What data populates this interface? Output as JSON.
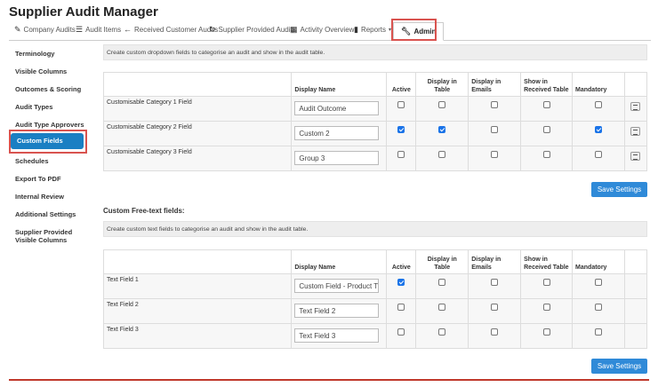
{
  "app": {
    "title": "Supplier Audit Manager"
  },
  "nav": {
    "items": [
      {
        "icon": "edit-icon",
        "label": "Company Audits"
      },
      {
        "icon": "list-icon",
        "label": "Audit Items"
      },
      {
        "icon": "arrow-left-icon",
        "label": "Received Customer Audits"
      },
      {
        "icon": "refresh-icon",
        "label": "Supplier Provided Audits"
      },
      {
        "icon": "table-icon",
        "label": "Activity Overview"
      },
      {
        "icon": "file-icon",
        "label": "Reports"
      },
      {
        "icon": "wrench-icon",
        "label": "Admin"
      }
    ]
  },
  "sidebar": {
    "items": [
      {
        "label": "Terminology"
      },
      {
        "label": "Visible Columns"
      },
      {
        "label": "Outcomes & Scoring"
      },
      {
        "label": "Audit Types"
      },
      {
        "label": "Audit Type Approvers"
      },
      {
        "label": "Custom Fields",
        "active": true
      },
      {
        "label": "Schedules"
      },
      {
        "label": "Export To PDF"
      },
      {
        "label": "Internal Review"
      },
      {
        "label": "Additional Settings"
      },
      {
        "label": "Supplier Provided Visible Columns"
      }
    ]
  },
  "dropdown_section": {
    "description": "Create custom dropdown fields to categorise an audit and show in the audit table.",
    "headers": [
      "",
      "Display Name",
      "Active",
      "Display in Table",
      "Display in Emails",
      "Show in Received Table",
      "Mandatory",
      ""
    ],
    "rows": [
      {
        "name": "Customisable Category 1 Field",
        "display_name": "Audit Outcome",
        "active": false,
        "table": false,
        "emails": false,
        "received": false,
        "mandatory": false
      },
      {
        "name": "Customisable Category 2 Field",
        "display_name": "Custom 2",
        "active": true,
        "table": true,
        "emails": false,
        "received": false,
        "mandatory": true
      },
      {
        "name": "Customisable Category 3 Field",
        "display_name": "Group 3",
        "active": false,
        "table": false,
        "emails": false,
        "received": false,
        "mandatory": false
      }
    ],
    "save_label": "Save Settings"
  },
  "freetext_section": {
    "title": "Custom Free-text fields:",
    "description": "Create custom text fields to categorise an audit and show in the audit table.",
    "headers": [
      "",
      "Display Name",
      "Active",
      "Display in Table",
      "Display in Emails",
      "Show in Received Table",
      "Mandatory",
      ""
    ],
    "rows": [
      {
        "name": "Text Field 1",
        "display_name": "Custom Field - Product Ty",
        "active": true,
        "table": false,
        "emails": false,
        "received": false,
        "mandatory": false
      },
      {
        "name": "Text Field 2",
        "display_name": "Text Field 2",
        "active": false,
        "table": false,
        "emails": false,
        "received": false,
        "mandatory": false
      },
      {
        "name": "Text Field 3",
        "display_name": "Text Field 3",
        "active": false,
        "table": false,
        "emails": false,
        "received": false,
        "mandatory": false
      }
    ],
    "save_label": "Save Settings"
  },
  "colors": {
    "accent": "#1a7fc3",
    "button": "#2f8ad8",
    "highlight": "#d9534f"
  }
}
